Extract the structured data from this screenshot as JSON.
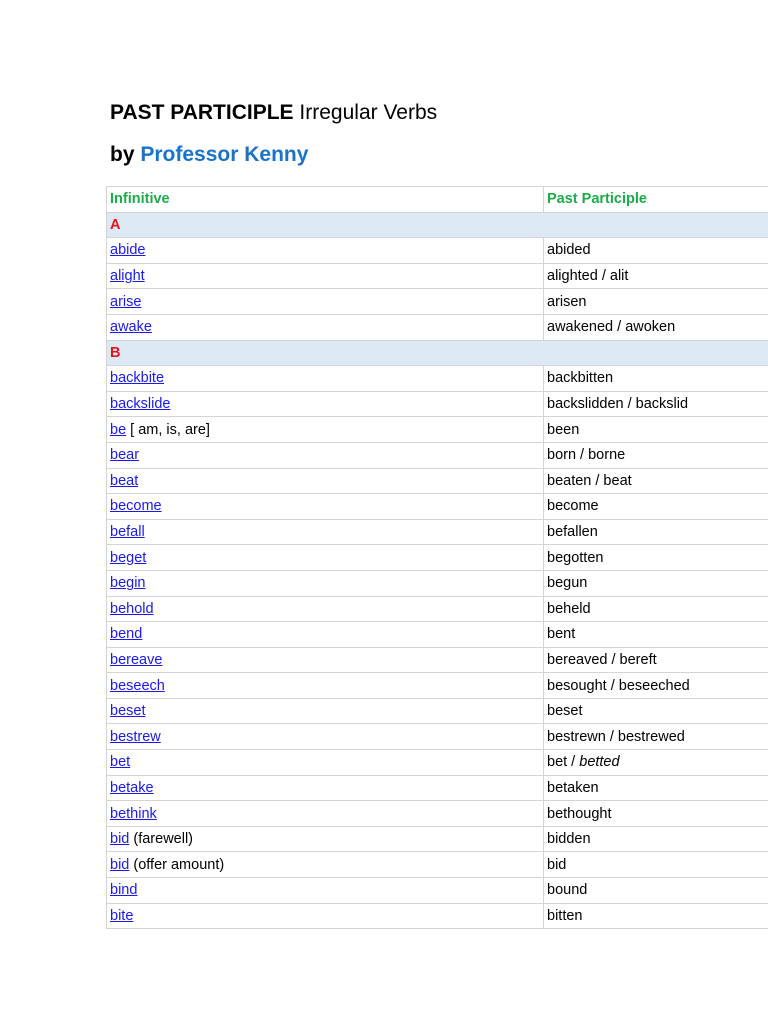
{
  "document": {
    "title_bold": "PAST PARTICIPLE",
    "title_rest": "Irregular Verbs",
    "byline_prefix": "by",
    "author": "Professor Kenny"
  },
  "table": {
    "headers": {
      "infinitive": "Infinitive",
      "past_participle": "Past Participle"
    },
    "sections": [
      {
        "letter": "A",
        "rows": [
          {
            "verb": "abide",
            "note": "",
            "pp": "abided",
            "pp_alt": ""
          },
          {
            "verb": "alight",
            "note": "",
            "pp": "alighted / alit",
            "pp_alt": ""
          },
          {
            "verb": "arise",
            "note": "",
            "pp": "arisen",
            "pp_alt": ""
          },
          {
            "verb": "awake",
            "note": "",
            "pp": "awakened / awoken",
            "pp_alt": ""
          }
        ]
      },
      {
        "letter": "B",
        "rows": [
          {
            "verb": "backbite",
            "note": "",
            "pp": "backbitten",
            "pp_alt": ""
          },
          {
            "verb": "backslide",
            "note": "",
            "pp": "backslidden / backslid",
            "pp_alt": ""
          },
          {
            "verb": "be",
            "note": " [ am, is, are]",
            "pp": "been",
            "pp_alt": ""
          },
          {
            "verb": "bear",
            "note": "",
            "pp": "born / borne",
            "pp_alt": ""
          },
          {
            "verb": "beat",
            "note": "",
            "pp": "beaten / beat",
            "pp_alt": ""
          },
          {
            "verb": "become",
            "note": "",
            "pp": "become",
            "pp_alt": ""
          },
          {
            "verb": "befall",
            "note": "",
            "pp": "befallen",
            "pp_alt": ""
          },
          {
            "verb": "beget",
            "note": "",
            "pp": "begotten",
            "pp_alt": ""
          },
          {
            "verb": "begin",
            "note": "",
            "pp": "begun",
            "pp_alt": ""
          },
          {
            "verb": "behold",
            "note": "",
            "pp": "beheld",
            "pp_alt": ""
          },
          {
            "verb": "bend",
            "note": "",
            "pp": "bent",
            "pp_alt": ""
          },
          {
            "verb": "bereave",
            "note": "",
            "pp": "bereaved / bereft",
            "pp_alt": ""
          },
          {
            "verb": "beseech",
            "note": "",
            "pp": "besought / beseeched",
            "pp_alt": ""
          },
          {
            "verb": "beset",
            "note": "",
            "pp": "beset",
            "pp_alt": ""
          },
          {
            "verb": "bestrew",
            "note": "",
            "pp": "bestrewn / bestrewed",
            "pp_alt": ""
          },
          {
            "verb": "bet",
            "note": "",
            "pp": "bet / ",
            "pp_alt": "betted"
          },
          {
            "verb": "betake",
            "note": "",
            "pp": "betaken",
            "pp_alt": ""
          },
          {
            "verb": "bethink",
            "note": "",
            "pp": "bethought",
            "pp_alt": ""
          },
          {
            "verb": "bid",
            "note": " (farewell)",
            "pp": "bidden",
            "pp_alt": ""
          },
          {
            "verb": "bid",
            "note": " (offer amount)",
            "pp": "bid",
            "pp_alt": ""
          },
          {
            "verb": "bind",
            "note": "",
            "pp": "bound",
            "pp_alt": ""
          },
          {
            "verb": "bite",
            "note": "",
            "pp": "bitten",
            "pp_alt": ""
          }
        ]
      }
    ]
  }
}
